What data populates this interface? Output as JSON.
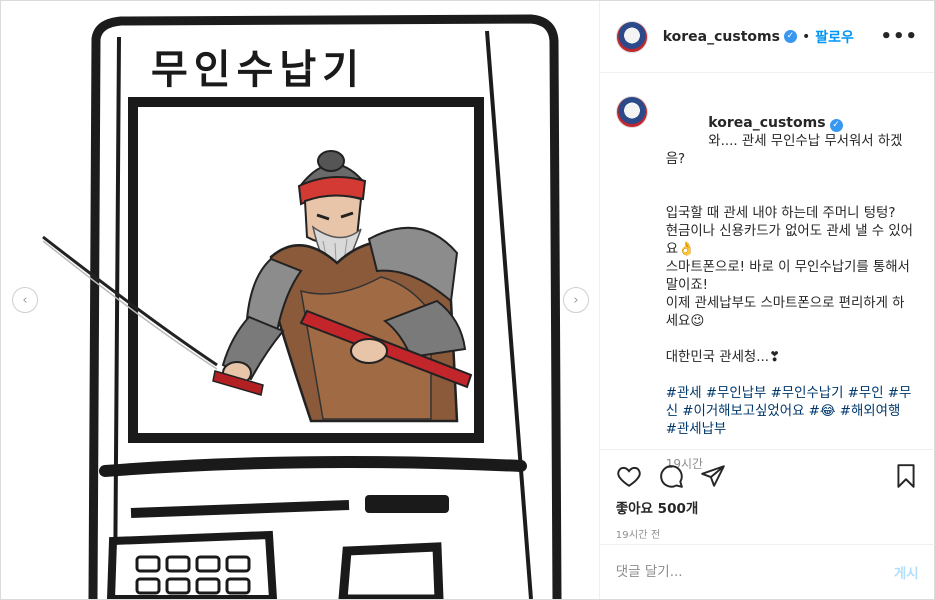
{
  "post": {
    "username": "korea_customs",
    "follow_label": "팔로우",
    "more_label": "•••",
    "image": {
      "sign_text": "무인수납기",
      "prev_icon": "chevron-left-icon",
      "next_icon": "chevron-right-icon"
    },
    "caption": {
      "lead": "와.... 관세 무인수납 무서워서 하겠음?",
      "body": "입국할 때 관세 내야 하는데 주머니 텅텅?\n현금이나 신용카드가 없어도 관세 낼 수 있어요👌\n스마트폰으로! 바로 이 무인수납기를 통해서 말이죠!\n이제 관세납부도 스마트폰으로 편리하게 하세요😉\n\n대한민국 관세청...❣",
      "hashtags": "#관세 #무인납부 #무인수납기 #무인 #무신 #이거해보고싶었어요 #😂 #해외여행 #관세납부",
      "time": "19시간"
    },
    "likes_label": "좋아요 500개",
    "time_ago": "19시간 전",
    "comment_placeholder": "댓글 달기...",
    "post_button": "게시"
  },
  "colors": {
    "link": "#0095f6",
    "hashtag": "#00376b",
    "muted": "#8e8e8e",
    "verified": "#3897f0"
  }
}
